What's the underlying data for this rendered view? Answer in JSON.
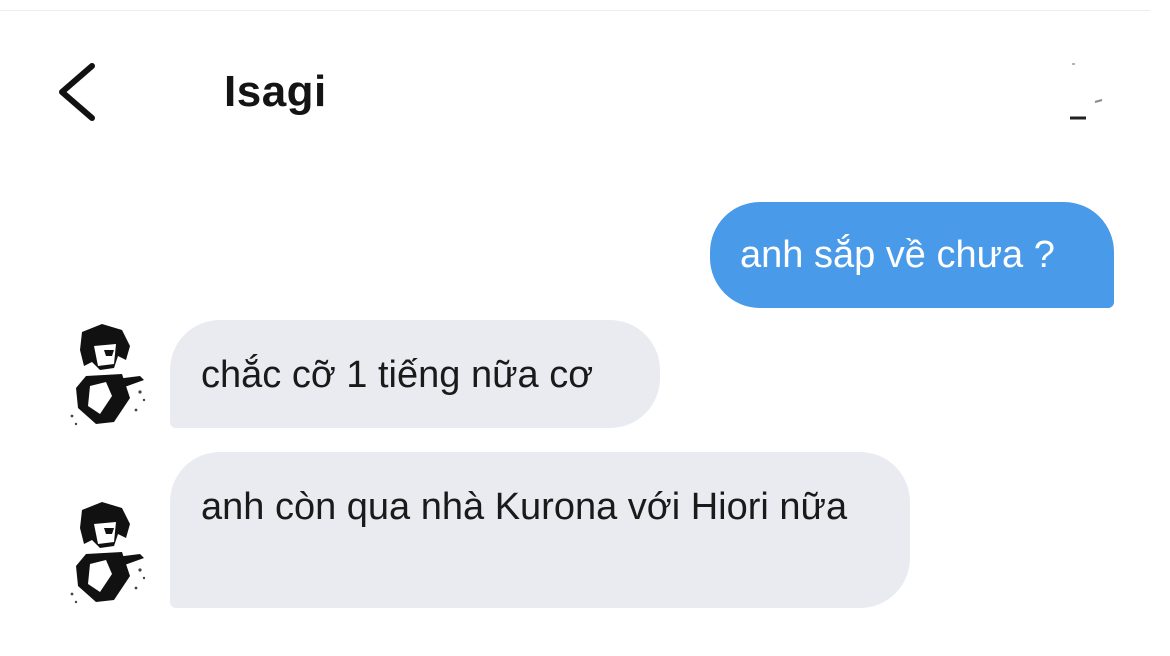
{
  "header": {
    "contact_name": "Isagi",
    "back_icon": "chevron-left-icon"
  },
  "messages": [
    {
      "direction": "outgoing",
      "text": "anh sắp về chưa ?"
    },
    {
      "direction": "incoming",
      "text": "chắc cỡ 1 tiếng nữa cơ",
      "avatar": "anime-avatar"
    },
    {
      "direction": "incoming",
      "text": "anh còn qua nhà Kurona với Hiori nữa",
      "avatar": "anime-avatar"
    }
  ],
  "colors": {
    "outgoing_bubble": "#4a9aea",
    "incoming_bubble": "#e9ebf0",
    "outgoing_text": "#ffffff",
    "incoming_text": "#1a1a1a",
    "title_text": "#141414"
  }
}
